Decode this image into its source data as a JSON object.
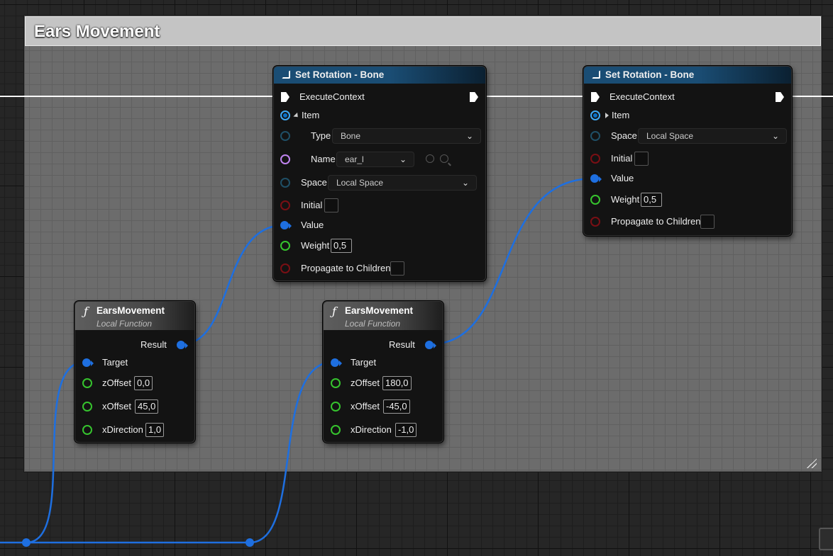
{
  "comment": {
    "title": "Ears Movement"
  },
  "nodes": {
    "set_rotation_1": {
      "title": "Set Rotation - Bone",
      "exec_label": "ExecuteContext",
      "item_label": "Item",
      "type_label": "Type",
      "type_value": "Bone",
      "name_label": "Name",
      "name_value": "ear_l",
      "space_label": "Space",
      "space_value": "Local Space",
      "initial_label": "Initial",
      "value_label": "Value",
      "weight_label": "Weight",
      "weight_value": "0,5",
      "propagate_label": "Propagate to Children"
    },
    "set_rotation_2": {
      "title": "Set Rotation - Bone",
      "exec_label": "ExecuteContext",
      "item_label": "Item",
      "space_label": "Space",
      "space_value": "Local Space",
      "initial_label": "Initial",
      "value_label": "Value",
      "weight_label": "Weight",
      "weight_value": "0,5",
      "propagate_label": "Propagate to Children"
    },
    "ears_movement_1": {
      "title": "EarsMovement",
      "subtitle": "Local Function",
      "icon": "ƒ",
      "result_label": "Result",
      "target_label": "Target",
      "zoffset_label": "zOffset",
      "zoffset_value": "0,0",
      "xoffset_label": "xOffset",
      "xoffset_value": "45,0",
      "xdirection_label": "xDirection",
      "xdirection_value": "1,0"
    },
    "ears_movement_2": {
      "title": "EarsMovement",
      "subtitle": "Local Function",
      "icon": "ƒ",
      "result_label": "Result",
      "target_label": "Target",
      "zoffset_label": "zOffset",
      "zoffset_value": "180,0",
      "xoffset_label": "xOffset",
      "xoffset_value": "-45,0",
      "xdirection_label": "xDirection",
      "xdirection_value": "-1,0"
    }
  },
  "colors": {
    "node_header_blue": "#1a4d74",
    "wire_blue": "#1e6fe0",
    "exec_white": "#ffffff",
    "pin_green": "#36c42e",
    "pin_red": "#7a0f14",
    "pin_purple": "#c084f0",
    "comment_header": "#c4c4c4"
  }
}
